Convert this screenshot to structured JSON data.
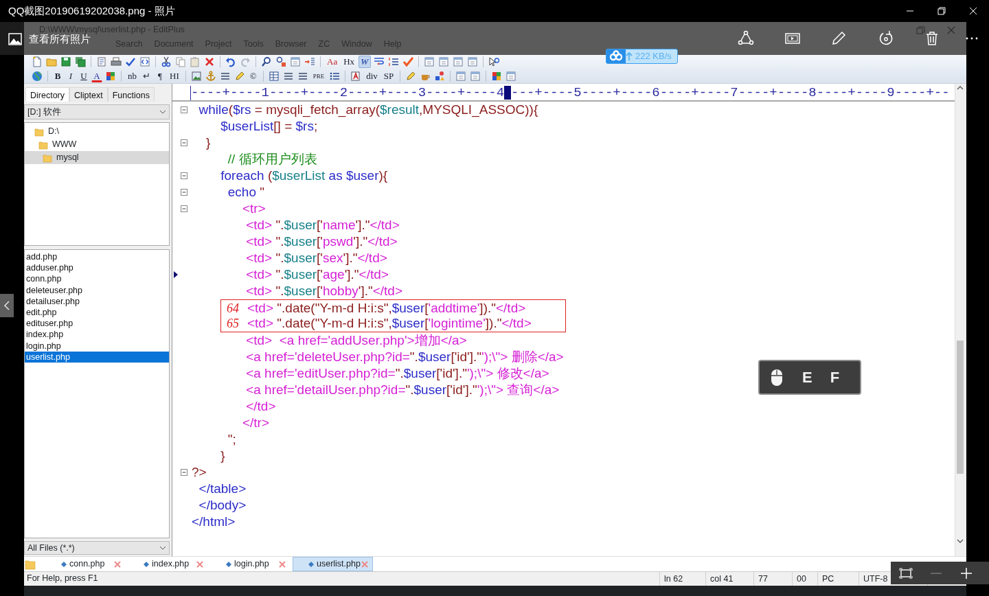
{
  "window": {
    "title": "QQ截图20190619202038.png - 照片"
  },
  "viewer": {
    "back_label": "查看所有照片"
  },
  "editor_window": {
    "title": "D:\\WWW\\mysql\\userlist.php - EditPlus"
  },
  "menu": [
    "Search",
    "Document",
    "Project",
    "Tools",
    "Browser",
    "ZC",
    "Window",
    "Help"
  ],
  "toolbar_1_buttons": [
    {
      "label": "Aa",
      "pressed": false
    },
    {
      "label": "Hx",
      "pressed": false
    },
    {
      "label": "W",
      "pressed": true
    }
  ],
  "toolbar_2_buttons": [
    "B",
    "I",
    "U",
    "A",
    "nb",
    "↵",
    "¶",
    "HI",
    "©",
    "PRE",
    "div",
    "SP"
  ],
  "upload_badge": {
    "speed": "222 KB/s"
  },
  "sidebar": {
    "tabs": [
      {
        "label": "Directory",
        "selected": true
      },
      {
        "label": "Cliptext",
        "selected": false
      },
      {
        "label": "Functions",
        "selected": false
      }
    ],
    "drive": "[D:] 软件",
    "folders": [
      {
        "label": "D:\\",
        "selected": false,
        "children": [
          {
            "label": "WWW",
            "selected": false,
            "children": [
              {
                "label": "mysql",
                "selected": true
              }
            ]
          }
        ]
      }
    ],
    "files": [
      {
        "label": "add.php",
        "selected": false
      },
      {
        "label": "adduser.php",
        "selected": false
      },
      {
        "label": "conn.php",
        "selected": false
      },
      {
        "label": "deleteuser.php",
        "selected": false
      },
      {
        "label": "detailuser.php",
        "selected": false
      },
      {
        "label": "edit.php",
        "selected": false
      },
      {
        "label": "edituser.php",
        "selected": false
      },
      {
        "label": "index.php",
        "selected": false
      },
      {
        "label": "login.php",
        "selected": false
      },
      {
        "label": "userlist.php",
        "selected": true
      }
    ],
    "filter": "All Files (*.*)"
  },
  "ruler": {
    "left": "----+----1----+----2----+----3----+----4",
    "right": "---+----5----+----6----+----7----+----8----+----9----+--"
  },
  "code_lines": [
    {
      "fold": true,
      "current": false,
      "tokens": [
        {
          "kind": "kw",
          "text": "  while"
        },
        {
          "kind": "br",
          "text": "("
        },
        {
          "kind": "kw",
          "text": "$rs"
        },
        {
          "kind": "br",
          "text": " = mysqli_fetch_array("
        },
        {
          "kind": "var",
          "text": "$result"
        },
        {
          "kind": "br",
          "text": ",MYSQLI_ASSOC)){"
        }
      ]
    },
    {
      "fold": false,
      "current": false,
      "tokens": [
        {
          "kind": "kw",
          "text": "        $userList"
        },
        {
          "kind": "br",
          "text": "[] = "
        },
        {
          "kind": "kw",
          "text": "$rs"
        },
        {
          "kind": "br",
          "text": ";"
        }
      ]
    },
    {
      "fold": true,
      "current": false,
      "tokens": [
        {
          "kind": "br",
          "text": "    }"
        }
      ]
    },
    {
      "fold": false,
      "current": false,
      "tokens": [
        {
          "kind": "cm",
          "text": "          // 循环用户列表"
        }
      ]
    },
    {
      "fold": true,
      "current": false,
      "tokens": [
        {
          "kind": "kw",
          "text": "        foreach "
        },
        {
          "kind": "br",
          "text": "("
        },
        {
          "kind": "var",
          "text": "$userList"
        },
        {
          "kind": "kw",
          "text": " as $user"
        },
        {
          "kind": "br",
          "text": "){"
        }
      ]
    },
    {
      "fold": true,
      "current": false,
      "tokens": [
        {
          "kind": "kw",
          "text": "          echo "
        },
        {
          "kind": "br",
          "text": "\""
        }
      ]
    },
    {
      "fold": true,
      "current": false,
      "tokens": [
        {
          "kind": "tag",
          "text": "              <tr>"
        }
      ]
    },
    {
      "fold": false,
      "current": false,
      "tokens": [
        {
          "kind": "tag",
          "text": "               <td> "
        },
        {
          "kind": "br",
          "text": "\"."
        },
        {
          "kind": "var",
          "text": "$user"
        },
        {
          "kind": "br",
          "text": "['"
        },
        {
          "kind": "tag",
          "text": "name"
        },
        {
          "kind": "br",
          "text": "'].\""
        },
        {
          "kind": "tag",
          "text": "</td>"
        }
      ]
    },
    {
      "fold": false,
      "current": false,
      "tokens": [
        {
          "kind": "tag",
          "text": "               <td> "
        },
        {
          "kind": "br",
          "text": "\"."
        },
        {
          "kind": "var",
          "text": "$user"
        },
        {
          "kind": "br",
          "text": "['"
        },
        {
          "kind": "tag",
          "text": "pswd"
        },
        {
          "kind": "br",
          "text": "'].\""
        },
        {
          "kind": "tag",
          "text": "</td>"
        }
      ]
    },
    {
      "fold": false,
      "current": false,
      "tokens": [
        {
          "kind": "tag",
          "text": "               <td> "
        },
        {
          "kind": "br",
          "text": "\"."
        },
        {
          "kind": "var",
          "text": "$user"
        },
        {
          "kind": "br",
          "text": "['"
        },
        {
          "kind": "tag",
          "text": "sex"
        },
        {
          "kind": "br",
          "text": "'].\""
        },
        {
          "kind": "tag",
          "text": "</td>"
        }
      ]
    },
    {
      "fold": false,
      "current": true,
      "tokens": [
        {
          "kind": "tag",
          "text": "               <td> "
        },
        {
          "kind": "br",
          "text": "\"."
        },
        {
          "kind": "var",
          "text": "$user"
        },
        {
          "kind": "br",
          "text": "['"
        },
        {
          "kind": "tag",
          "text": "age"
        },
        {
          "kind": "br",
          "text": "'].\""
        },
        {
          "kind": "tag",
          "text": "</td>"
        }
      ]
    },
    {
      "fold": false,
      "current": false,
      "tokens": [
        {
          "kind": "tag",
          "text": "               <td> "
        },
        {
          "kind": "br",
          "text": "\"."
        },
        {
          "kind": "var",
          "text": "$user"
        },
        {
          "kind": "br",
          "text": "['"
        },
        {
          "kind": "tag",
          "text": "hobby"
        },
        {
          "kind": "br",
          "text": "'].\""
        },
        {
          "kind": "tag",
          "text": "</td>"
        }
      ]
    },
    {
      "annotation": "64",
      "tokens": [
        {
          "kind": "tag",
          "text": "<td> "
        },
        {
          "kind": "br",
          "text": "\".date(\"Y-m-d H:i:s\","
        },
        {
          "kind": "kw",
          "text": "$user"
        },
        {
          "kind": "br",
          "text": "["
        },
        {
          "kind": "tag",
          "text": "'addtime'"
        },
        {
          "kind": "br",
          "text": "]).\""
        },
        {
          "kind": "tag",
          "text": "</td>"
        }
      ]
    },
    {
      "annotation": "65",
      "tokens": [
        {
          "kind": "tag",
          "text": "<td> "
        },
        {
          "kind": "br",
          "text": "\".date(\"Y-m-d H:i:s\","
        },
        {
          "kind": "kw",
          "text": "$user"
        },
        {
          "kind": "br",
          "text": "["
        },
        {
          "kind": "tag",
          "text": "'logintime'"
        },
        {
          "kind": "br",
          "text": "]).\""
        },
        {
          "kind": "tag",
          "text": "</td>"
        }
      ]
    },
    {
      "fold": false,
      "current": false,
      "tokens": [
        {
          "kind": "tag",
          "text": "               <td>  <a href='addUser.php'>增加</a>"
        }
      ]
    },
    {
      "fold": false,
      "current": false,
      "tokens": [
        {
          "kind": "tag",
          "text": "               <a href='deleteUser.php?id="
        },
        {
          "kind": "br",
          "text": "\"."
        },
        {
          "kind": "kw",
          "text": "$user"
        },
        {
          "kind": "br",
          "text": "['id'].\""
        },
        {
          "kind": "tag",
          "text": "');\\\"> 删除</a>"
        }
      ]
    },
    {
      "fold": false,
      "current": false,
      "tokens": [
        {
          "kind": "tag",
          "text": "               <a href='editUser.php?id="
        },
        {
          "kind": "br",
          "text": "\"."
        },
        {
          "kind": "kw",
          "text": "$user"
        },
        {
          "kind": "br",
          "text": "['id'].\""
        },
        {
          "kind": "tag",
          "text": "');\\\"> 修改</a>"
        }
      ]
    },
    {
      "fold": false,
      "current": false,
      "tokens": [
        {
          "kind": "tag",
          "text": "               <a href='detailUser.php?id="
        },
        {
          "kind": "br",
          "text": "\"."
        },
        {
          "kind": "kw",
          "text": "$user"
        },
        {
          "kind": "br",
          "text": "['id'].\""
        },
        {
          "kind": "tag",
          "text": "');\\\"> 查询</a>"
        }
      ]
    },
    {
      "fold": false,
      "current": false,
      "tokens": [
        {
          "kind": "tag",
          "text": "               </td>"
        }
      ]
    },
    {
      "fold": false,
      "current": false,
      "tokens": [
        {
          "kind": "tag",
          "text": "              </tr>"
        }
      ]
    },
    {
      "fold": false,
      "current": false,
      "tokens": [
        {
          "kind": "br",
          "text": "          \";"
        }
      ]
    },
    {
      "fold": false,
      "current": false,
      "tokens": [
        {
          "kind": "br",
          "text": "        }"
        }
      ]
    },
    {
      "fold": true,
      "current": false,
      "tokens": [
        {
          "kind": "br",
          "text": "?>"
        }
      ]
    },
    {
      "fold": false,
      "current": false,
      "tokens": [
        {
          "kind": "kw",
          "text": "  </table>"
        }
      ]
    },
    {
      "fold": false,
      "current": false,
      "tokens": [
        {
          "kind": "kw",
          "text": "  </body>"
        }
      ]
    },
    {
      "fold": false,
      "current": false,
      "tokens": [
        {
          "kind": "kw",
          "text": "</html>"
        }
      ]
    }
  ],
  "popup": {
    "keys": [
      "E",
      "F"
    ]
  },
  "file_tabs": [
    {
      "label": "conn.php",
      "selected": false
    },
    {
      "label": "index.php",
      "selected": false
    },
    {
      "label": "login.php",
      "selected": false
    },
    {
      "label": "userlist.php",
      "selected": true
    }
  ],
  "status_bar": {
    "help": "For Help, press F1",
    "cells": [
      "ln 62",
      "col 41",
      "77",
      "00",
      "PC",
      "UTF-8"
    ]
  }
}
